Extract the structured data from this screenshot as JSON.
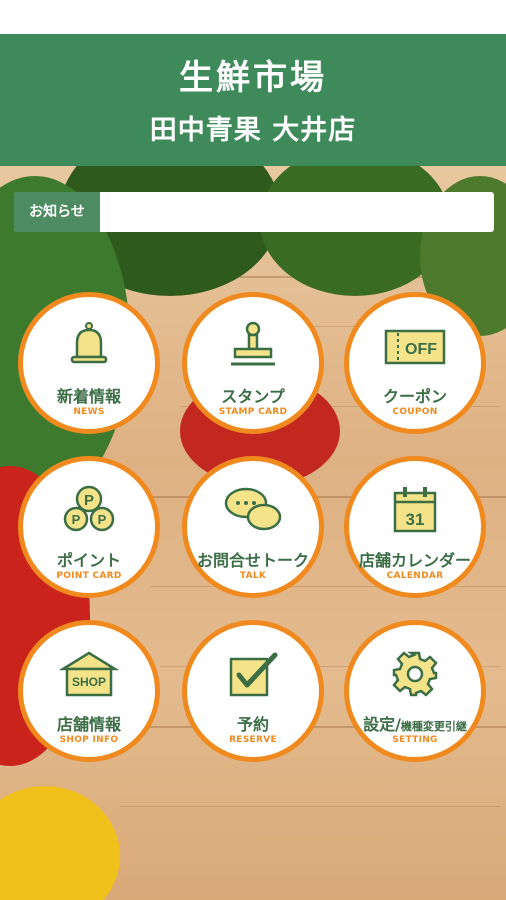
{
  "header": {
    "title": "生鮮市場",
    "subtitle": "田中青果 大井店"
  },
  "notice": {
    "label": "お知らせ",
    "text": ""
  },
  "menu": [
    {
      "jp": "新着情報",
      "en": "NEWS",
      "icon": "bell-icon"
    },
    {
      "jp": "スタンプ",
      "en": "STAMP CARD",
      "icon": "stamp-icon"
    },
    {
      "jp": "クーポン",
      "en": "COUPON",
      "icon": "coupon-icon",
      "icon_text": "OFF"
    },
    {
      "jp": "ポイント",
      "en": "POINT CARD",
      "icon": "points-icon",
      "icon_text": "P"
    },
    {
      "jp": "お問合せトーク",
      "en": "TALK",
      "icon": "chat-bubbles-icon"
    },
    {
      "jp": "店舗カレンダー",
      "en": "CALENDAR",
      "icon": "calendar-icon",
      "icon_text": "31"
    },
    {
      "jp": "店舗情報",
      "en": "SHOP INFO",
      "icon": "shop-icon",
      "icon_text": "SHOP"
    },
    {
      "jp": "予約",
      "en": "RESERVE",
      "icon": "checkbox-icon"
    },
    {
      "jp": "設定/",
      "jp_small": "機種変更引継",
      "en": "SETTING",
      "icon": "gear-icon"
    }
  ],
  "colors": {
    "header": "#3f8a5b",
    "tile_border": "#f08a1e",
    "label_green": "#3c6e46"
  }
}
